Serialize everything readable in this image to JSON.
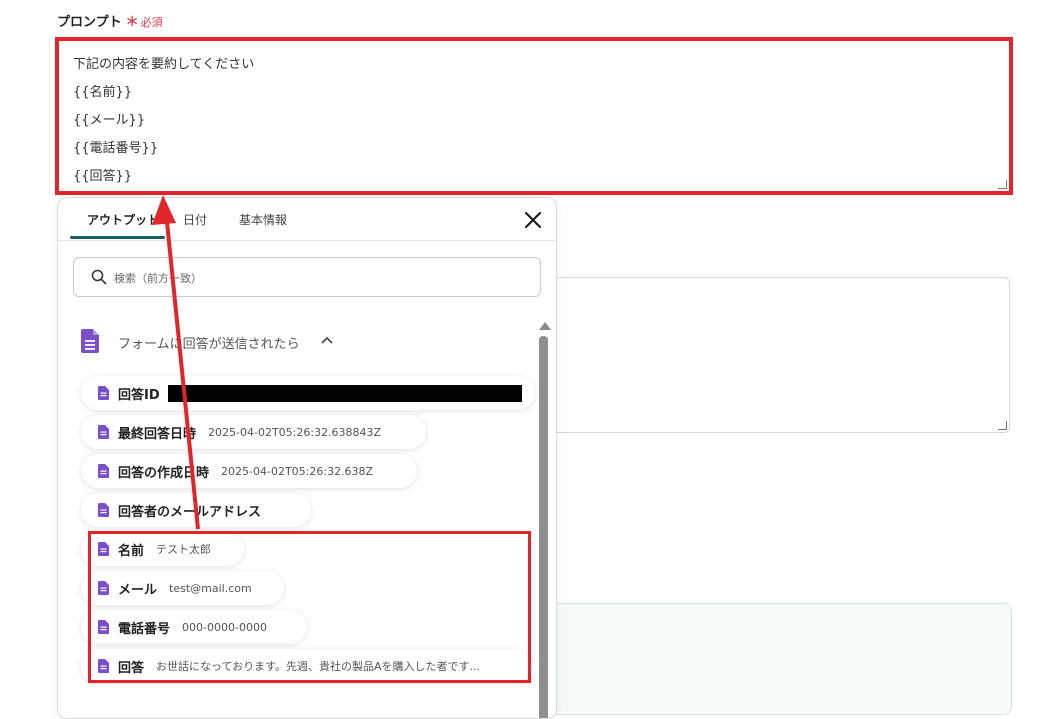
{
  "field": {
    "label": "プロンプト",
    "required_star": "＊",
    "required_text": "必須"
  },
  "prompt": {
    "lines": [
      "下記の内容を要約してください",
      "{{名前}}",
      "{{メール}}",
      "{{電話番号}}",
      "{{回答}}"
    ]
  },
  "panel": {
    "tabs": [
      {
        "label": "アウトプット",
        "active": true
      },
      {
        "label": "日付",
        "active": false
      },
      {
        "label": "基本情報",
        "active": false
      }
    ],
    "search_placeholder": "検索（前方一致）",
    "section_title": "フォームに回答が送信されたら",
    "items": [
      {
        "label": "回答ID",
        "value": ""
      },
      {
        "label": "最終回答日時",
        "value": "2025-04-02T05:26:32.638843Z"
      },
      {
        "label": "回答の作成日時",
        "value": "2025-04-02T05:26:32.638Z"
      },
      {
        "label": "回答者のメールアドレス",
        "value": ""
      },
      {
        "label": "名前",
        "value": "テスト太郎"
      },
      {
        "label": "メール",
        "value": "test@mail.com"
      },
      {
        "label": "電話番号",
        "value": "000-0000-0000"
      },
      {
        "label": "回答",
        "value": "お世話になっております。先週、貴社の製品Aを購入した者です..."
      }
    ]
  },
  "colors": {
    "highlight": "#e0262b",
    "doc_icon": "#7b4fc9",
    "tab_accent": "#17616a",
    "required": "#e33b4e"
  },
  "icons": [
    "doc-icon",
    "search-icon",
    "close-icon",
    "chevron-up-icon",
    "scroll-up-icon"
  ]
}
